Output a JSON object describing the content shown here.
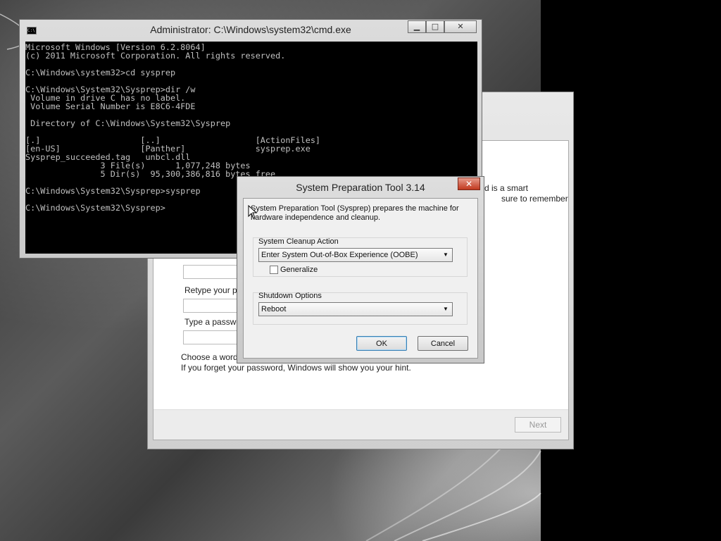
{
  "cmd": {
    "title": "Administrator: C:\\Windows\\system32\\cmd.exe",
    "icon": "C:\\",
    "lines": [
      "Microsoft Windows [Version 6.2.8064]",
      "(c) 2011 Microsoft Corporation. All rights reserved.",
      "",
      "C:\\Windows\\system32>cd sysprep",
      "",
      "C:\\Windows\\System32\\Sysprep>dir /w",
      " Volume in drive C has no label.",
      " Volume Serial Number is E8C6-4FDE",
      "",
      " Directory of C:\\Windows\\System32\\Sysprep",
      "",
      "[.]                    [..]                   [ActionFiles]",
      "[en-US]                [Panther]              sysprep.exe",
      "Sysprep_succeeded.tag   unbcl.dll",
      "               3 File(s)      1,077,248 bytes",
      "               5 Dir(s)  95,300,386,816 bytes free",
      "",
      "C:\\Windows\\System32\\Sysprep>sysprep",
      "",
      "C:\\Windows\\System32\\Sysprep>"
    ],
    "minimize": "▁",
    "maximize": "□",
    "close": "✕"
  },
  "setup": {
    "partial_text_1": "d is a smart",
    "partial_text_2": "sure to remember",
    "retype_label": "Retype your p",
    "hint_label": "Type a passwo",
    "choose_word": "Choose a word",
    "forget_hint": "If you forget your password, Windows will show you your hint.",
    "next_label": "Next"
  },
  "sysprep": {
    "title": "System Preparation Tool 3.14",
    "close": "✕",
    "description_1": "System Preparation Tool (Sysprep) prepares the machine for",
    "description_2": "hardware independence and cleanup.",
    "cleanup_label": "System Cleanup Action",
    "cleanup_value": "Enter System Out-of-Box Experience (OOBE)",
    "generalize_label": "Generalize",
    "shutdown_label": "Shutdown Options",
    "shutdown_value": "Reboot",
    "ok_label": "OK",
    "cancel_label": "Cancel"
  },
  "colors": {
    "console_bg": "#000000",
    "console_text": "#c0c0c0",
    "close_red": "#c1391f"
  }
}
